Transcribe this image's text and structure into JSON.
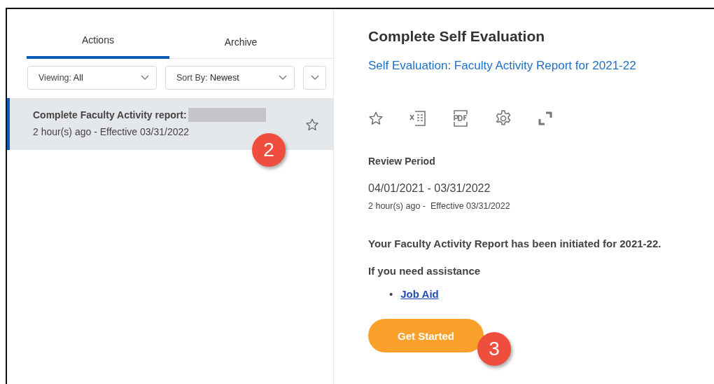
{
  "tabs": [
    {
      "label": "Actions",
      "selected": true
    },
    {
      "label": "Archive",
      "selected": false
    }
  ],
  "filters": [
    {
      "label": "Viewing:",
      "value": "All"
    },
    {
      "label": "Sort By:",
      "value": "Newest"
    }
  ],
  "inbox_items": [
    {
      "title": "Complete Faculty Activity report:",
      "subtitle": "2 hour(s) ago - Effective 03/31/2022",
      "selected": true,
      "starred": false,
      "redacted": true
    }
  ],
  "detail": {
    "title": "Complete Self Evaluation",
    "link": "Self Evaluation: Faculty Activity Report for 2021-22",
    "section_label": "Review Period",
    "period": "04/01/2021 - 03/31/2022",
    "timestamp": "2 hour(s) ago -  Effective 03/31/2022",
    "message": "Your Faculty Activity Report has been initiated for 2021-22.",
    "assistance": "If you need assistance",
    "links": [
      {
        "bullet": "•",
        "label": "Job Aid"
      }
    ],
    "button": "Get Started"
  },
  "step_badges": [
    {
      "label": "2",
      "kind": "item"
    },
    {
      "label": "3",
      "kind": "button"
    }
  ]
}
